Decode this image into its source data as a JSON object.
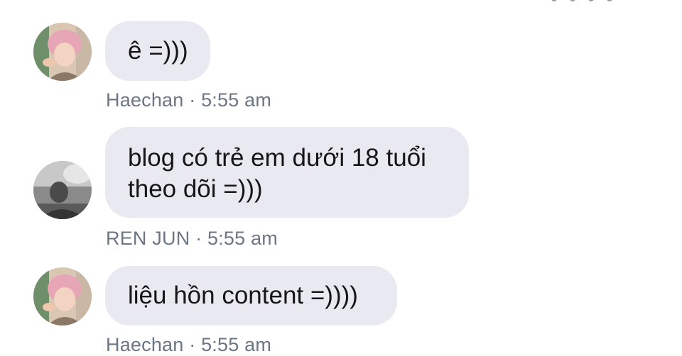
{
  "messages": [
    {
      "sender": "Haechan",
      "time": "5:55 am",
      "lines": [
        "ê =)))"
      ],
      "avatar_icon": "profile-photo-pink-hair"
    },
    {
      "sender": "REN JUN",
      "time": "5:55 am",
      "lines": [
        "blog có trẻ em dưới 18 tuổi",
        "theo dõi =)))"
      ],
      "avatar_icon": "profile-photo-grayscale"
    },
    {
      "sender": "Haechan",
      "time": "5:55 am",
      "lines": [
        "liệu hồn content =))))"
      ],
      "avatar_icon": "profile-photo-pink-hair"
    }
  ],
  "meta_separator": "·",
  "colors": {
    "bubble_bg": "#e9e9f1",
    "message_text": "#161618",
    "meta_text": "#6a7684",
    "background": "#ffffff"
  }
}
